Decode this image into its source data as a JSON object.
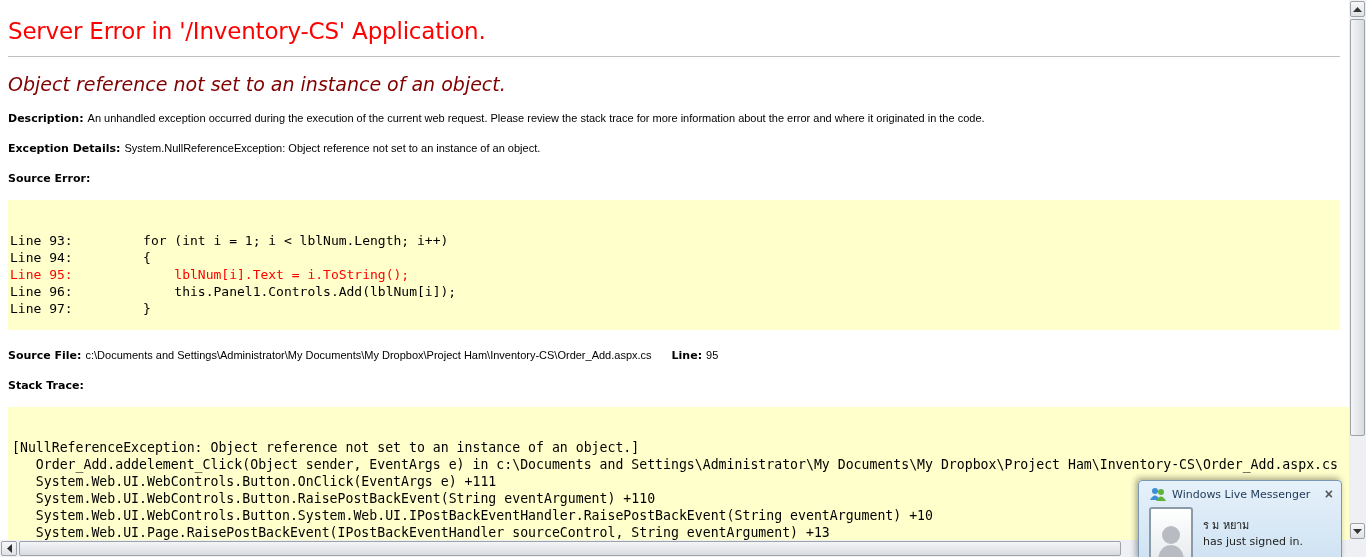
{
  "title": "Server Error in '/Inventory-CS' Application.",
  "error_message": "Object reference not set to an instance of an object.",
  "fields": [
    {
      "label": "Description:",
      "text": "An unhandled exception occurred during the execution of the current web request. Please review the stack trace for more information about the error and where it originated in the code."
    },
    {
      "label": "Exception Details:",
      "text": "System.NullReferenceException: Object reference not set to an instance of an object."
    }
  ],
  "source_error": {
    "label": "Source Error:",
    "lines": [
      {
        "text": "Line 93:         for (int i = 1; i < lblNum.Length; i++)",
        "highlighted": false
      },
      {
        "text": "Line 94:         {",
        "highlighted": false
      },
      {
        "text": "Line 95:             lblNum[i].Text = i.ToString();",
        "highlighted": true
      },
      {
        "text": "Line 96:             this.Panel1.Controls.Add(lblNum[i]);",
        "highlighted": false
      },
      {
        "text": "Line 97:         }",
        "highlighted": false
      }
    ]
  },
  "source_file": {
    "label": "Source File:",
    "path": "c:\\Documents and Settings\\Administrator\\My Documents\\My Dropbox\\Project Ham\\Inventory-CS\\Order_Add.aspx.cs",
    "line_label": "Line:",
    "line": "95"
  },
  "stack_trace": {
    "label": "Stack Trace:",
    "lines": [
      "[NullReferenceException: Object reference not set to an instance of an object.]",
      "   Order_Add.addelement_Click(Object sender, EventArgs e) in c:\\Documents and Settings\\Administrator\\My Documents\\My Dropbox\\Project Ham\\Inventory-CS\\Order_Add.aspx.cs",
      "   System.Web.UI.WebControls.Button.OnClick(EventArgs e) +111",
      "   System.Web.UI.WebControls.Button.RaisePostBackEvent(String eventArgument) +110",
      "   System.Web.UI.WebControls.Button.System.Web.UI.IPostBackEventHandler.RaisePostBackEvent(String eventArgument) +10",
      "   System.Web.UI.Page.RaisePostBackEvent(IPostBackEventHandler sourceControl, String eventArgument) +13"
    ]
  },
  "notification": {
    "title": "Windows Live Messenger",
    "close": "×",
    "name": "ร ม หยาม",
    "message": "has just signed in."
  }
}
